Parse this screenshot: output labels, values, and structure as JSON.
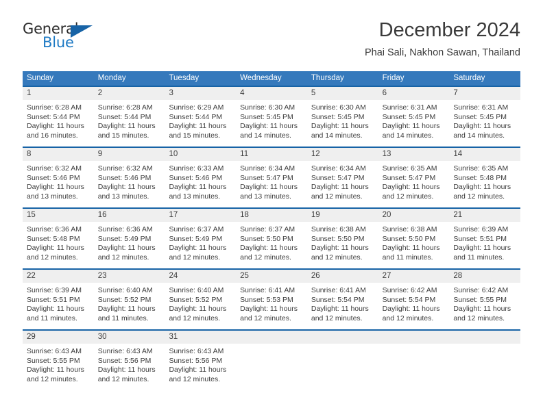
{
  "brand": {
    "name_part1": "General",
    "name_part2": "Blue",
    "logo_icon": "triangle-flag-icon",
    "accent_color": "#1763a6",
    "blue_text_color": "#1e7ac4"
  },
  "header": {
    "title": "December 2024",
    "subtitle": "Phai Sali, Nakhon Sawan, Thailand"
  },
  "theme": {
    "header_bg": "#3579bc",
    "row_border": "#1763a6",
    "day_band_bg": "#efefef",
    "text": "#3c3c3c"
  },
  "weekdays": [
    "Sunday",
    "Monday",
    "Tuesday",
    "Wednesday",
    "Thursday",
    "Friday",
    "Saturday"
  ],
  "weeks": [
    [
      {
        "day": "1",
        "sunrise": "Sunrise: 6:28 AM",
        "sunset": "Sunset: 5:44 PM",
        "daylight": "Daylight: 11 hours and 16 minutes."
      },
      {
        "day": "2",
        "sunrise": "Sunrise: 6:28 AM",
        "sunset": "Sunset: 5:44 PM",
        "daylight": "Daylight: 11 hours and 15 minutes."
      },
      {
        "day": "3",
        "sunrise": "Sunrise: 6:29 AM",
        "sunset": "Sunset: 5:44 PM",
        "daylight": "Daylight: 11 hours and 15 minutes."
      },
      {
        "day": "4",
        "sunrise": "Sunrise: 6:30 AM",
        "sunset": "Sunset: 5:45 PM",
        "daylight": "Daylight: 11 hours and 14 minutes."
      },
      {
        "day": "5",
        "sunrise": "Sunrise: 6:30 AM",
        "sunset": "Sunset: 5:45 PM",
        "daylight": "Daylight: 11 hours and 14 minutes."
      },
      {
        "day": "6",
        "sunrise": "Sunrise: 6:31 AM",
        "sunset": "Sunset: 5:45 PM",
        "daylight": "Daylight: 11 hours and 14 minutes."
      },
      {
        "day": "7",
        "sunrise": "Sunrise: 6:31 AM",
        "sunset": "Sunset: 5:45 PM",
        "daylight": "Daylight: 11 hours and 14 minutes."
      }
    ],
    [
      {
        "day": "8",
        "sunrise": "Sunrise: 6:32 AM",
        "sunset": "Sunset: 5:46 PM",
        "daylight": "Daylight: 11 hours and 13 minutes."
      },
      {
        "day": "9",
        "sunrise": "Sunrise: 6:32 AM",
        "sunset": "Sunset: 5:46 PM",
        "daylight": "Daylight: 11 hours and 13 minutes."
      },
      {
        "day": "10",
        "sunrise": "Sunrise: 6:33 AM",
        "sunset": "Sunset: 5:46 PM",
        "daylight": "Daylight: 11 hours and 13 minutes."
      },
      {
        "day": "11",
        "sunrise": "Sunrise: 6:34 AM",
        "sunset": "Sunset: 5:47 PM",
        "daylight": "Daylight: 11 hours and 13 minutes."
      },
      {
        "day": "12",
        "sunrise": "Sunrise: 6:34 AM",
        "sunset": "Sunset: 5:47 PM",
        "daylight": "Daylight: 11 hours and 12 minutes."
      },
      {
        "day": "13",
        "sunrise": "Sunrise: 6:35 AM",
        "sunset": "Sunset: 5:47 PM",
        "daylight": "Daylight: 11 hours and 12 minutes."
      },
      {
        "day": "14",
        "sunrise": "Sunrise: 6:35 AM",
        "sunset": "Sunset: 5:48 PM",
        "daylight": "Daylight: 11 hours and 12 minutes."
      }
    ],
    [
      {
        "day": "15",
        "sunrise": "Sunrise: 6:36 AM",
        "sunset": "Sunset: 5:48 PM",
        "daylight": "Daylight: 11 hours and 12 minutes."
      },
      {
        "day": "16",
        "sunrise": "Sunrise: 6:36 AM",
        "sunset": "Sunset: 5:49 PM",
        "daylight": "Daylight: 11 hours and 12 minutes."
      },
      {
        "day": "17",
        "sunrise": "Sunrise: 6:37 AM",
        "sunset": "Sunset: 5:49 PM",
        "daylight": "Daylight: 11 hours and 12 minutes."
      },
      {
        "day": "18",
        "sunrise": "Sunrise: 6:37 AM",
        "sunset": "Sunset: 5:50 PM",
        "daylight": "Daylight: 11 hours and 12 minutes."
      },
      {
        "day": "19",
        "sunrise": "Sunrise: 6:38 AM",
        "sunset": "Sunset: 5:50 PM",
        "daylight": "Daylight: 11 hours and 12 minutes."
      },
      {
        "day": "20",
        "sunrise": "Sunrise: 6:38 AM",
        "sunset": "Sunset: 5:50 PM",
        "daylight": "Daylight: 11 hours and 11 minutes."
      },
      {
        "day": "21",
        "sunrise": "Sunrise: 6:39 AM",
        "sunset": "Sunset: 5:51 PM",
        "daylight": "Daylight: 11 hours and 11 minutes."
      }
    ],
    [
      {
        "day": "22",
        "sunrise": "Sunrise: 6:39 AM",
        "sunset": "Sunset: 5:51 PM",
        "daylight": "Daylight: 11 hours and 11 minutes."
      },
      {
        "day": "23",
        "sunrise": "Sunrise: 6:40 AM",
        "sunset": "Sunset: 5:52 PM",
        "daylight": "Daylight: 11 hours and 11 minutes."
      },
      {
        "day": "24",
        "sunrise": "Sunrise: 6:40 AM",
        "sunset": "Sunset: 5:52 PM",
        "daylight": "Daylight: 11 hours and 12 minutes."
      },
      {
        "day": "25",
        "sunrise": "Sunrise: 6:41 AM",
        "sunset": "Sunset: 5:53 PM",
        "daylight": "Daylight: 11 hours and 12 minutes."
      },
      {
        "day": "26",
        "sunrise": "Sunrise: 6:41 AM",
        "sunset": "Sunset: 5:54 PM",
        "daylight": "Daylight: 11 hours and 12 minutes."
      },
      {
        "day": "27",
        "sunrise": "Sunrise: 6:42 AM",
        "sunset": "Sunset: 5:54 PM",
        "daylight": "Daylight: 11 hours and 12 minutes."
      },
      {
        "day": "28",
        "sunrise": "Sunrise: 6:42 AM",
        "sunset": "Sunset: 5:55 PM",
        "daylight": "Daylight: 11 hours and 12 minutes."
      }
    ],
    [
      {
        "day": "29",
        "sunrise": "Sunrise: 6:43 AM",
        "sunset": "Sunset: 5:55 PM",
        "daylight": "Daylight: 11 hours and 12 minutes."
      },
      {
        "day": "30",
        "sunrise": "Sunrise: 6:43 AM",
        "sunset": "Sunset: 5:56 PM",
        "daylight": "Daylight: 11 hours and 12 minutes."
      },
      {
        "day": "31",
        "sunrise": "Sunrise: 6:43 AM",
        "sunset": "Sunset: 5:56 PM",
        "daylight": "Daylight: 11 hours and 12 minutes."
      },
      {
        "day": "",
        "sunrise": "",
        "sunset": "",
        "daylight": ""
      },
      {
        "day": "",
        "sunrise": "",
        "sunset": "",
        "daylight": ""
      },
      {
        "day": "",
        "sunrise": "",
        "sunset": "",
        "daylight": ""
      },
      {
        "day": "",
        "sunrise": "",
        "sunset": "",
        "daylight": ""
      }
    ]
  ]
}
